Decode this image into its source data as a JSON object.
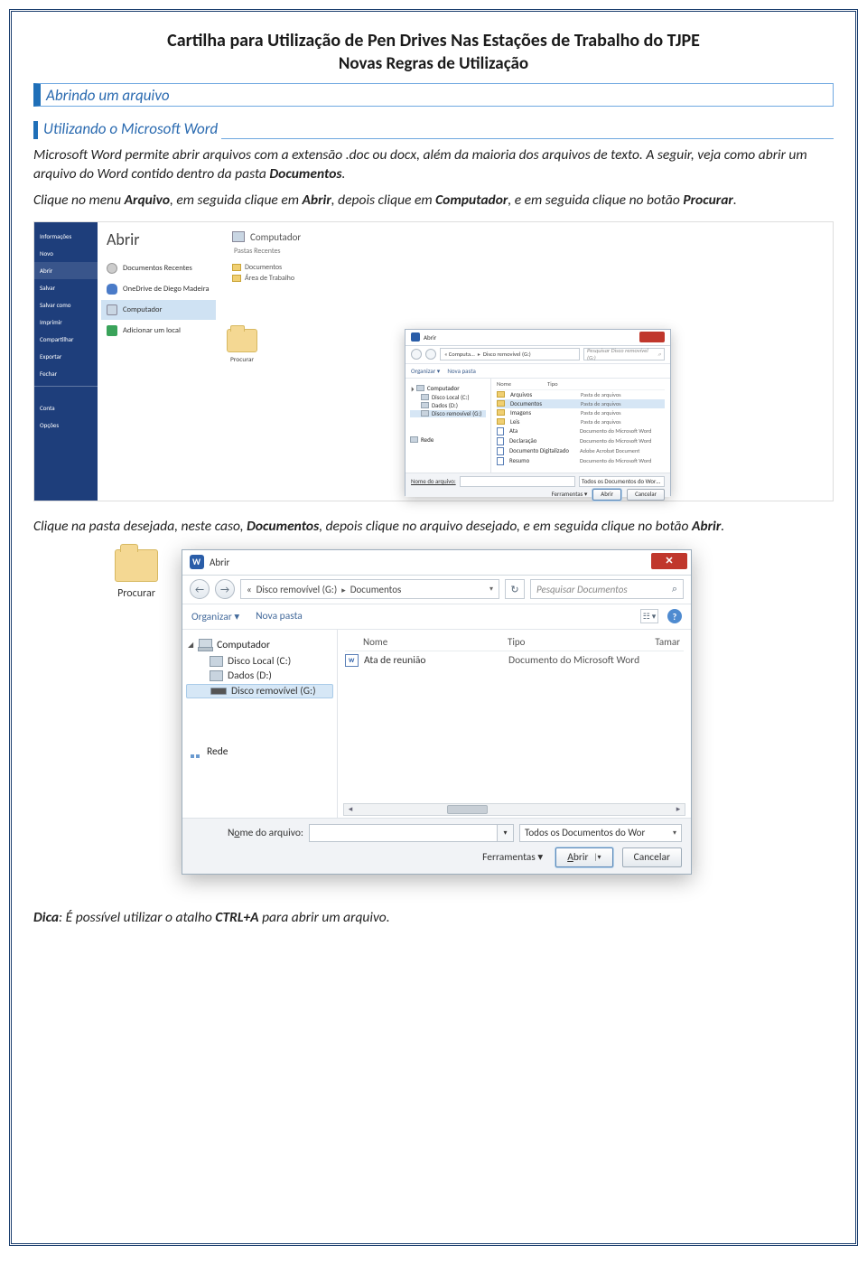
{
  "header": {
    "title": "Cartilha para Utilização de Pen Drives Nas Estações de Trabalho do TJPE",
    "subtitle": "Novas Regras de Utilização"
  },
  "section1": "Abrindo um arquivo",
  "section2": "Utilizando o Microsoft Word",
  "para1_a": "Microsoft Word permite abrir arquivos com a extensão .doc ou docx, além da maioria dos arquivos de texto. A seguir, veja como abrir um arquivo do Word contido dentro da pasta ",
  "para1_b": "Documentos",
  "para1_c": ".",
  "para2_a": "Clique no menu ",
  "para2_b": "Arquivo",
  "para2_c": ", em seguida clique em ",
  "para2_d": "Abrir",
  "para2_e": ", depois clique em ",
  "para2_f": "Computador",
  "para2_g": ", e em seguida clique no botão ",
  "para2_h": "Procurar",
  "para2_i": ".",
  "wordshot": {
    "backstage_title": "Abrir",
    "left_menu": [
      "Informações",
      "Novo",
      "Abrir",
      "Salvar",
      "Salvar como",
      "Imprimir",
      "Compartilhar",
      "Exportar",
      "Fechar",
      "Conta",
      "Opções"
    ],
    "mid": {
      "recent": "Documentos Recentes",
      "onedrive": "OneDrive de Diego Madeira",
      "computer": "Computador",
      "addloc": "Adicionar um local"
    },
    "right": {
      "computer": "Computador",
      "recent_folders": "Pastas Recentes",
      "documents": "Documentos",
      "desktop": "Área de Trabalho"
    },
    "procurar": "Procurar"
  },
  "opendlg_small": {
    "title": "Abrir",
    "crumb": [
      "« Computa...",
      "Disco removível (G:)"
    ],
    "search_ph": "Pesquisar Disco removível (G:)",
    "organize": "Organizar ▾",
    "newfolder": "Nova pasta",
    "col_name": "Nome",
    "col_type": "Tipo",
    "nav_computer": "Computador",
    "drives": [
      "Disco Local (C:)",
      "Dados (D:)",
      "Disco removível (G:)"
    ],
    "nav_network": "Rede",
    "rows": [
      {
        "n": "Arquivos",
        "t": "Pasta de arquivos",
        "k": "f"
      },
      {
        "n": "Documentos",
        "t": "Pasta de arquivos",
        "k": "f",
        "sel": true
      },
      {
        "n": "Imagens",
        "t": "Pasta de arquivos",
        "k": "f"
      },
      {
        "n": "Leis",
        "t": "Pasta de arquivos",
        "k": "f"
      },
      {
        "n": "Ata",
        "t": "Documento do Microsoft Word",
        "k": "d"
      },
      {
        "n": "Declaração",
        "t": "Documento do Microsoft Word",
        "k": "d"
      },
      {
        "n": "Documento Digitalizado",
        "t": "Adobe Acrobat Document",
        "k": "d"
      },
      {
        "n": "Resumo",
        "t": "Documento do Microsoft Word",
        "k": "d"
      }
    ],
    "fname_label": "Nome do arquivo:",
    "filter": "Todos os Documentos do Wor…",
    "tools": "Ferramentas ▾",
    "open_btn": "Abrir",
    "cancel_btn": "Cancelar"
  },
  "para3_a": "Clique na pasta desejada, neste caso, ",
  "para3_b": "Documentos",
  "para3_c": ", depois clique no arquivo desejado, e em seguida clique no botão ",
  "para3_d": "Abrir",
  "para3_e": ".",
  "bigdlg": {
    "title": "Abrir",
    "crumb_pre": "«",
    "crumb1": "Disco removível (G:)",
    "crumb2": "Documentos",
    "search_ph": "Pesquisar Documentos",
    "organize": "Organizar ▾",
    "newfolder": "Nova pasta",
    "col_name": "Nome",
    "col_type": "Tipo",
    "col_size": "Tamar",
    "nav_computer": "Computador",
    "drives": [
      "Disco Local (C:)",
      "Dados (D:)",
      "Disco removível (G:)"
    ],
    "nav_network": "Rede",
    "row_name": "Ata de reunião",
    "row_type": "Documento do Microsoft Word",
    "fname_label_pre": "N",
    "fname_label_ul": "o",
    "fname_label_post": "me do arquivo:",
    "filter": "Todos os Documentos do Wor",
    "tools": "Ferramentas  ▾",
    "open_btn_ul": "A",
    "open_btn_rest": "brir",
    "cancel_btn": "Cancelar"
  },
  "dica_a": "Dica",
  "dica_b": ": É possível utilizar o atalho ",
  "dica_c": "CTRL+A",
  "dica_d": " para abrir um arquivo."
}
